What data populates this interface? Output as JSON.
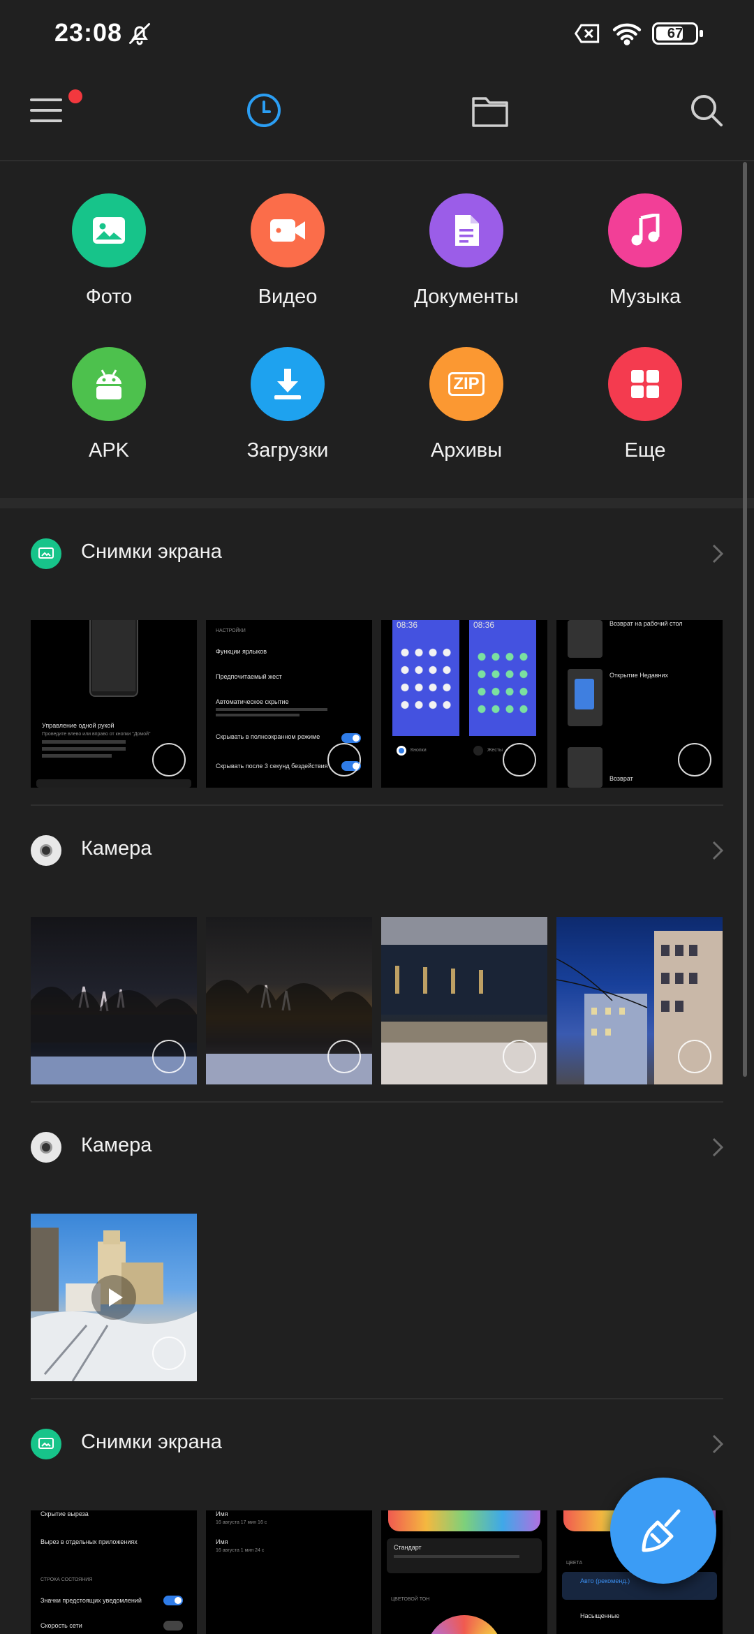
{
  "status_bar": {
    "time": "23:08",
    "battery": "67",
    "icons": [
      "bell-off-icon",
      "sim-x-icon",
      "wifi-icon",
      "battery-icon"
    ]
  },
  "toolbar": {
    "icons": [
      "menu-icon",
      "recent-clock-icon",
      "folder-icon",
      "search-icon"
    ],
    "active_tab": "recent",
    "accent_color": "#2b9ef3",
    "notification_dot_color": "#f2383e"
  },
  "categories": [
    {
      "label": "Фото",
      "icon": "photo-icon",
      "color": "#17c48a"
    },
    {
      "label": "Видео",
      "icon": "video-icon",
      "color": "#fb6d4a"
    },
    {
      "label": "Документы",
      "icon": "document-icon",
      "color": "#9b5de8"
    },
    {
      "label": "Музыка",
      "icon": "music-icon",
      "color": "#f23f97"
    },
    {
      "label": "APK",
      "icon": "android-icon",
      "color": "#4dc14d"
    },
    {
      "label": "Загрузки",
      "icon": "download-icon",
      "color": "#1ea2ef"
    },
    {
      "label": "Архивы",
      "icon": "zip-icon",
      "color": "#fb9832",
      "badge_text": "ZIP"
    },
    {
      "label": "Еще",
      "icon": "grid-icon",
      "color": "#f43b4f"
    }
  ],
  "sections": [
    {
      "title": "Снимки экрана",
      "icon": "screenshot-icon",
      "thumb_count": 4
    },
    {
      "title": "Камера",
      "icon": "camera-icon",
      "thumb_count": 4
    },
    {
      "title": "Камера",
      "icon": "camera-icon",
      "thumb_count": 1
    },
    {
      "title": "Снимки экрана",
      "icon": "screenshot-icon",
      "thumb_count": 4
    }
  ],
  "thumb_text": {
    "s1t1": [
      "Управление одной рукой",
      "Проведите влево или вправо от кнопки \"Домой\""
    ],
    "s1t2": [
      "НАСТРОЙКИ",
      "Функции ярлыков",
      "Предпочитаемый жест",
      "Автоматическое скрытие",
      "Скрывать в полноэкранном режиме",
      "Скрывать после 3 секунд бездействия"
    ],
    "s1t3": [
      "08:36",
      "08:36",
      "Кнопки",
      "Жесты"
    ],
    "s1t4": [
      "Возврат на рабочий стол",
      "Открытие Недавних",
      "Возврат"
    ],
    "s4t1": [
      "Скрытие выреза",
      "Вырез в отдельных приложениях",
      "СТРОКА СОСТОЯНИЯ",
      "Значки предстоящих уведомлений",
      "Скорость сети"
    ],
    "s4t2": [
      "Имя",
      "16 августа 17 мин 16 с",
      "Имя",
      "16 августа 1 мин 24 с"
    ],
    "s4t3": [
      "Стандарт",
      "ЦВЕТОВОЙ ТОН"
    ],
    "s4t4": [
      "ЦВЕТА",
      "Авто (рекоменд.)",
      "Насыщенные"
    ]
  },
  "fab": {
    "icon": "broom-clean-icon",
    "color": "#3b9cf5"
  }
}
